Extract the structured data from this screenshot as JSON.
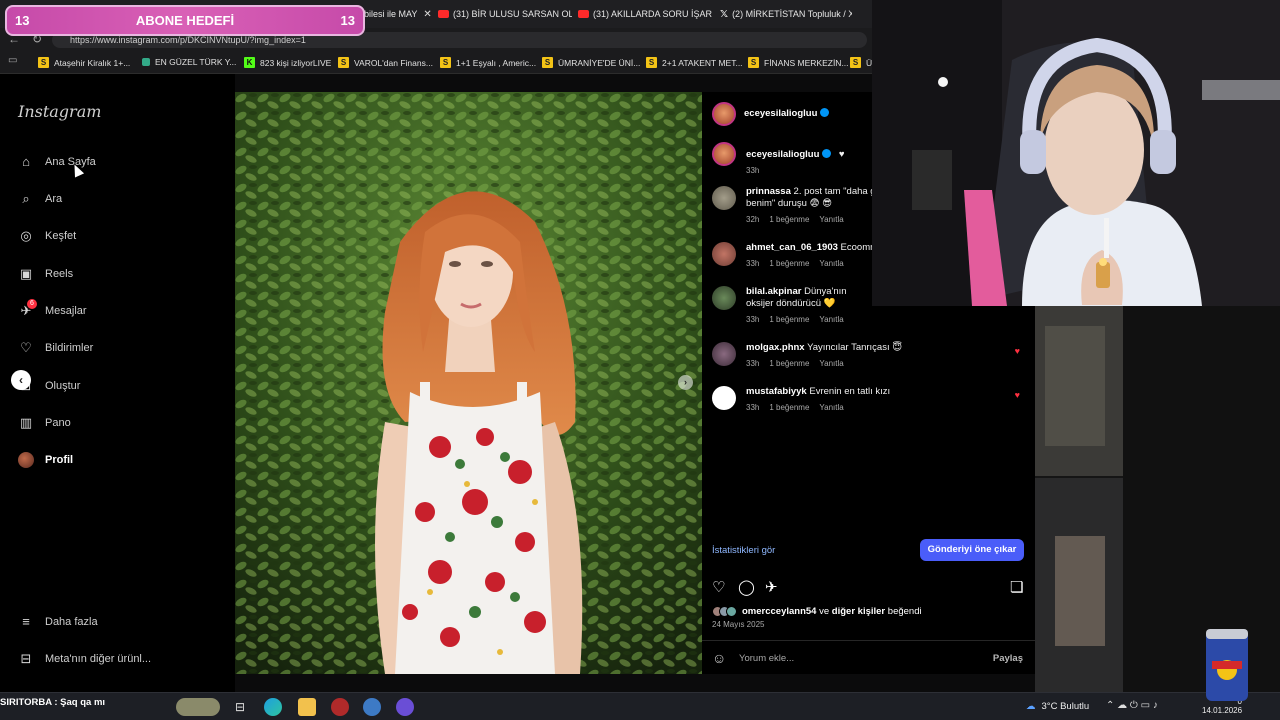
{
  "goal": {
    "left_count": "13",
    "title": "ABONE HEDEFİ",
    "right_count": "13"
  },
  "browser": {
    "tabs": [
      {
        "label": "bilesi ile MAY",
        "icon": "none"
      },
      {
        "label": "(31) BİR ULUSU SARSAN OLA",
        "icon": "youtube-icon"
      },
      {
        "label": "(31) AKILLARDA SORU İŞARE",
        "icon": "youtube-icon"
      },
      {
        "label": "(2) MİRKETİSTAN Topluluk / X",
        "icon": "x-icon"
      }
    ],
    "url": "https://www.instagram.com/p/DKCINVNtupU/?img_index=1",
    "bookmarks": [
      {
        "label": "Ataşehir Kiralık 1+...",
        "icon": "s"
      },
      {
        "label": "EN GÜZEL TÜRK Y...",
        "icon": "flag"
      },
      {
        "label": "823 kişi izliyorLIVE",
        "icon": "k"
      },
      {
        "label": "VAROL'dan Finans...",
        "icon": "s"
      },
      {
        "label": "1+1 Eşyalı , Americ...",
        "icon": "s"
      },
      {
        "label": "ÜMRANİYE'DE ÜNİ...",
        "icon": "s"
      },
      {
        "label": "2+1 ATAKENT MET...",
        "icon": "s"
      },
      {
        "label": "FİNANS MERKEZİN...",
        "icon": "s"
      },
      {
        "label": "Ü",
        "icon": "s"
      }
    ]
  },
  "instagram": {
    "logo": "Instagram",
    "nav": [
      {
        "label": "Ana Sayfa",
        "icon": "home-icon",
        "glyph": "⌂"
      },
      {
        "label": "Ara",
        "icon": "search-icon",
        "glyph": "⌕"
      },
      {
        "label": "Keşfet",
        "icon": "compass-icon",
        "glyph": "◎"
      },
      {
        "label": "Reels",
        "icon": "reels-icon",
        "glyph": "▣"
      },
      {
        "label": "Mesajlar",
        "icon": "messenger-icon",
        "glyph": "✈"
      },
      {
        "label": "Bildirimler",
        "icon": "heart-icon",
        "glyph": "♡"
      },
      {
        "label": "Oluştur",
        "icon": "plus-square-icon",
        "glyph": "⊞"
      },
      {
        "label": "Pano",
        "icon": "dashboard-icon",
        "glyph": "▥"
      },
      {
        "label": "Profil",
        "icon": "avatar",
        "glyph": ""
      }
    ],
    "messages_badge": "6",
    "more": {
      "label": "Daha fazla",
      "glyph": "≡"
    },
    "meta": {
      "label": "Meta'nın diğer ürünl...",
      "glyph": "⊟"
    }
  },
  "post": {
    "author": "eceyesilaliogluu",
    "caption_heart": "♥",
    "caption_time": "33h",
    "comments": [
      {
        "user": "prinnassa",
        "text": "2. post tam \"daha g benim\" duruşu 😨 😎",
        "time": "32h",
        "likes": "1 beğenme",
        "reply": "Yanıtla",
        "liked": false
      },
      {
        "user": "ahmet_can_06_1903",
        "text": "Ecoomm",
        "time": "33h",
        "likes": "1 beğenme",
        "reply": "Yanıtla",
        "liked": false
      },
      {
        "user": "bilal.akpinar",
        "text": "Dünya'nın oksijer döndürücü 💛",
        "time": "33h",
        "likes": "1 beğenme",
        "reply": "Yanıtla",
        "liked": false
      },
      {
        "user": "molgax.phnx",
        "text": "Yayıncılar Tanrıçası 😇",
        "time": "33h",
        "likes": "1 beğenme",
        "reply": "Yanıtla",
        "liked": true
      },
      {
        "user": "mustafabiyyk",
        "text": "Evrenin en tatlı kızı",
        "time": "33h",
        "likes": "1 beğenme",
        "reply": "Yanıtla",
        "liked": true
      }
    ],
    "stats_link": "İstatistikleri gör",
    "boost_button": "Gönderiyi öne çıkar",
    "liked_by_user": "omercceylann54",
    "liked_by_rest": "ve",
    "liked_by_others": "diğer kişiler",
    "liked_by_end": "beğendi",
    "date": "24 Mayıs 2025",
    "comment_placeholder": "Yorum ekle...",
    "share_label": "Paylaş"
  },
  "taskbar": {
    "ticker": "SIRITORBA : Şaq qa mı",
    "weather": "3°C Bulutlu",
    "time": "0",
    "date": "14.01.2026"
  },
  "colors": {
    "accent": "#4a5df9",
    "like": "#ff3040",
    "goal": "#d960b6"
  }
}
